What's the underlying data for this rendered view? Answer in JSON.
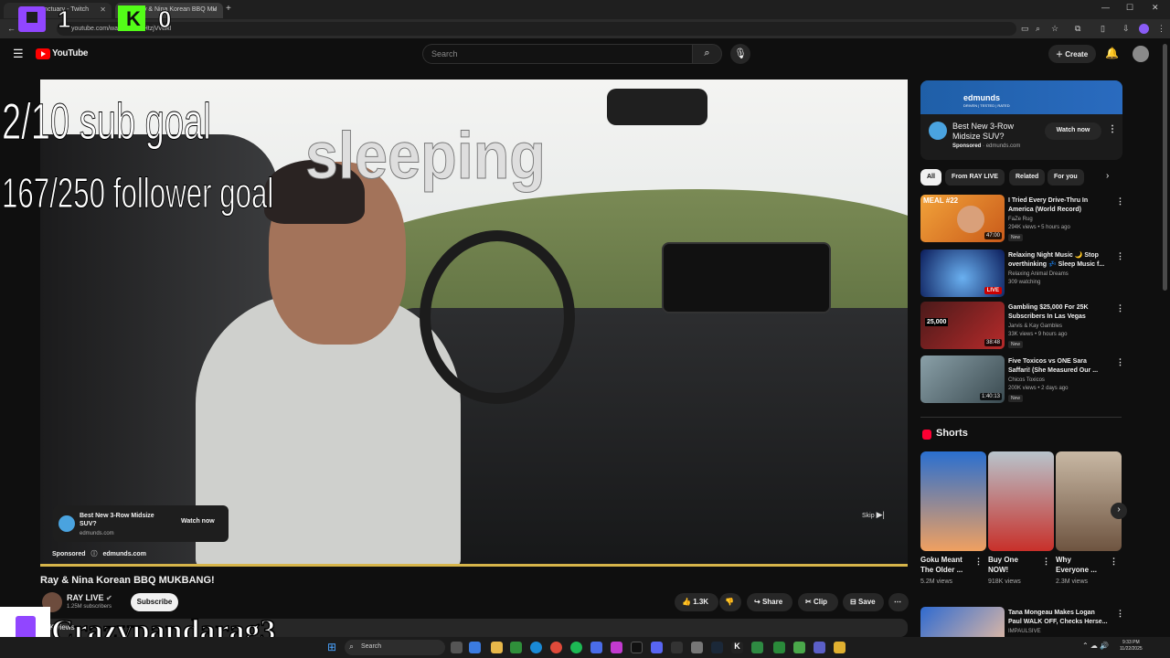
{
  "browser": {
    "tabs": [
      {
        "title": "yourSanctuary - Twitch"
      },
      {
        "title": "Ray & Nina Korean BBQ MU"
      }
    ],
    "url": "youtube.com/watch?v=cJHtzjVvwkI"
  },
  "header": {
    "logo_text": "YouTube",
    "search_placeholder": "Search",
    "create_label": "Create"
  },
  "stream_overlay": {
    "counter_left": "1",
    "counter_right": "0",
    "sub_goal": "2/10 sub goal",
    "follower_goal": "167/250 follower goal",
    "status": "sleeping",
    "streamer_name": "Crazypandarag3"
  },
  "video_ad": {
    "title": "Best New 3-Row Midsize SUV?",
    "domain": "edmunds.com",
    "cta": "Watch now",
    "sponsored_label": "Sponsored",
    "skip_label": "Skip"
  },
  "video": {
    "title": "Ray & Nina Korean BBQ MUKBANG!",
    "channel": "RAY LIVE",
    "subscribers": "1.25M subscribers",
    "subscribe_label": "Subscribe",
    "likes": "1.3K",
    "share_label": "Share",
    "clip_label": "Clip",
    "save_label": "Save",
    "description_views": "K views"
  },
  "sidebar_ad": {
    "banner_text": "edmunds",
    "banner_tagline": "DRIVEN | TESTED | RATED",
    "title": "Best New 3-Row Midsize SUV?",
    "sponsored_label": "Sponsored",
    "domain": "edmunds.com",
    "cta": "Watch now"
  },
  "chips": [
    "All",
    "From RAY LIVE",
    "Related",
    "For you"
  ],
  "recommendations": [
    {
      "title": "I Tried Every Drive-Thru In America (World Record)",
      "channel": "FaZe Rug",
      "meta": "294K views • 5 hours ago",
      "badge": "New",
      "duration": "47:00",
      "thumb_text": "MEAL #22"
    },
    {
      "title": "Relaxing Night Music 🌙 Stop overthinking 💤 Sleep Music f...",
      "channel": "Relaxing Animal Dreams",
      "meta": "309 watching",
      "badge": "",
      "duration": "LIVE",
      "thumb_text": ""
    },
    {
      "title": "Gambling $25,000 For 25K Subscribers In Las Vegas",
      "channel": "Jarvis & Kay Gambles",
      "meta": "33K views • 9 hours ago",
      "badge": "New",
      "duration": "38:48",
      "thumb_text": "25,000"
    },
    {
      "title": "Five Toxicos vs ONE Sara Saffari! (She Measured Our ...",
      "channel": "Chicos Toxicos",
      "meta": "200K views • 2 days ago",
      "badge": "New",
      "duration": "1:40:13",
      "thumb_text": ""
    }
  ],
  "shorts": {
    "heading": "Shorts",
    "items": [
      {
        "title": "Goku Meant The Older ...",
        "views": "5.2M views"
      },
      {
        "title": "Buy One NOW!",
        "views": "918K views"
      },
      {
        "title": "Why Everyone ...",
        "views": "2.3M views"
      }
    ]
  },
  "next_rec": {
    "title": "Tana Mongeau Makes Logan Paul WALK OFF, Checks Herse...",
    "channel": "IMPAULSIVE"
  },
  "taskbar": {
    "search_label": "Search",
    "time": "9:33 PM",
    "date": "11/22/2025"
  },
  "colors": {
    "yt_red": "#ff0000",
    "twitch_purple": "#9146ff",
    "kick_green": "#53fc18",
    "background": "#0f0f0f"
  }
}
